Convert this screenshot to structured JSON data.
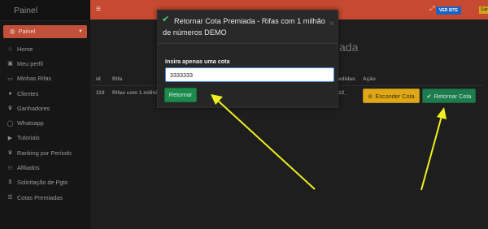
{
  "sidebar": {
    "brand": "Painel Administrativo",
    "active": {
      "label": "Painel",
      "icon": "palette-icon"
    },
    "items": [
      {
        "label": "Home",
        "icon": "home-icon"
      },
      {
        "label": "Meu perfil",
        "icon": "profile-icon"
      },
      {
        "label": "Minhas Rifas",
        "icon": "ticket-icon"
      },
      {
        "label": "Clientes",
        "icon": "users-icon"
      },
      {
        "label": "Ganhadores",
        "icon": "trophy-icon"
      },
      {
        "label": "Whatsapp",
        "icon": "whatsapp-icon"
      },
      {
        "label": "Tutoriais",
        "icon": "video-icon"
      },
      {
        "label": "Ranking por Período",
        "icon": "trophy-icon"
      },
      {
        "label": "Afiliados",
        "icon": "affiliates-icon"
      },
      {
        "label": "Solicitação de Pgto",
        "icon": "dollar-icon"
      },
      {
        "label": "Cotas Premiadas",
        "icon": "list-icon"
      }
    ]
  },
  "topbar": {
    "site_label": "VER SITE",
    "exit_label": "Sair",
    "colors": {
      "bar": "#c64a31",
      "site": "#1b64c4",
      "exit": "#d4a517"
    }
  },
  "main": {
    "title_fragment": "ada",
    "columns": [
      "id",
      "Rifa",
      "edidas",
      "Ação"
    ],
    "row": {
      "id": "119",
      "rifa": "Rifas com 1 milhõ",
      "sold": "22_"
    },
    "hide_label": "Esconder Cota",
    "return_label": "Retornar Cota"
  },
  "modal": {
    "title": "Retornar Cota Premiada - Rifas com 1 milhão de números DEMO",
    "input_label": "Insira apenas uma cota",
    "input_value": "3333333",
    "submit_label": "Retornar"
  }
}
